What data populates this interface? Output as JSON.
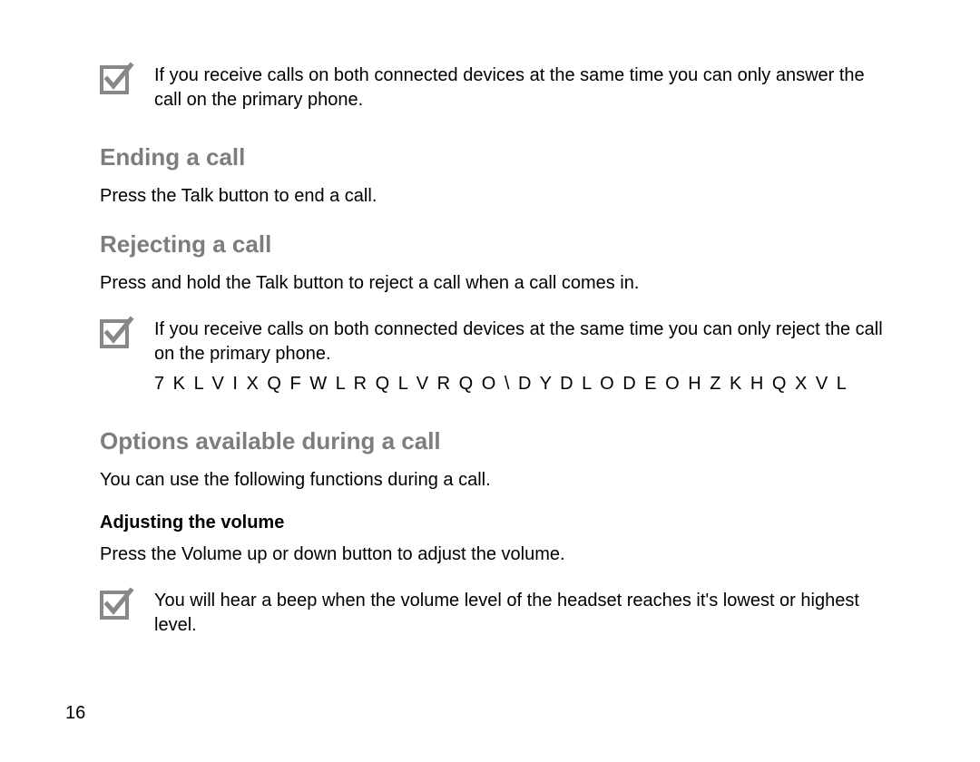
{
  "note1": "If you receive calls on both connected devices at the same time you can only answer the call on the primary phone.",
  "sec1": {
    "title": "Ending a call",
    "body": "Press the Talk button to end a call."
  },
  "sec2": {
    "title": "Rejecting a call",
    "body": "Press and hold the Talk button to reject a call when a call comes in."
  },
  "note2": {
    "line1": "If you receive calls on both connected devices at the same time you can only reject the call on the primary phone.",
    "line2": "7 K L V   I X Q F W L R Q   L V   R Q O \\   D Y D L O D E O H   Z K H Q   X V L"
  },
  "sec3": {
    "title": "Options available during a call",
    "body": "You can use the following functions during a call."
  },
  "sub1": {
    "title": "Adjusting the volume",
    "body": "Press the Volume up or down button to adjust the volume."
  },
  "note3": "You will hear a beep when the volume level of the headset reaches it's lowest or highest level.",
  "page_number": "16"
}
